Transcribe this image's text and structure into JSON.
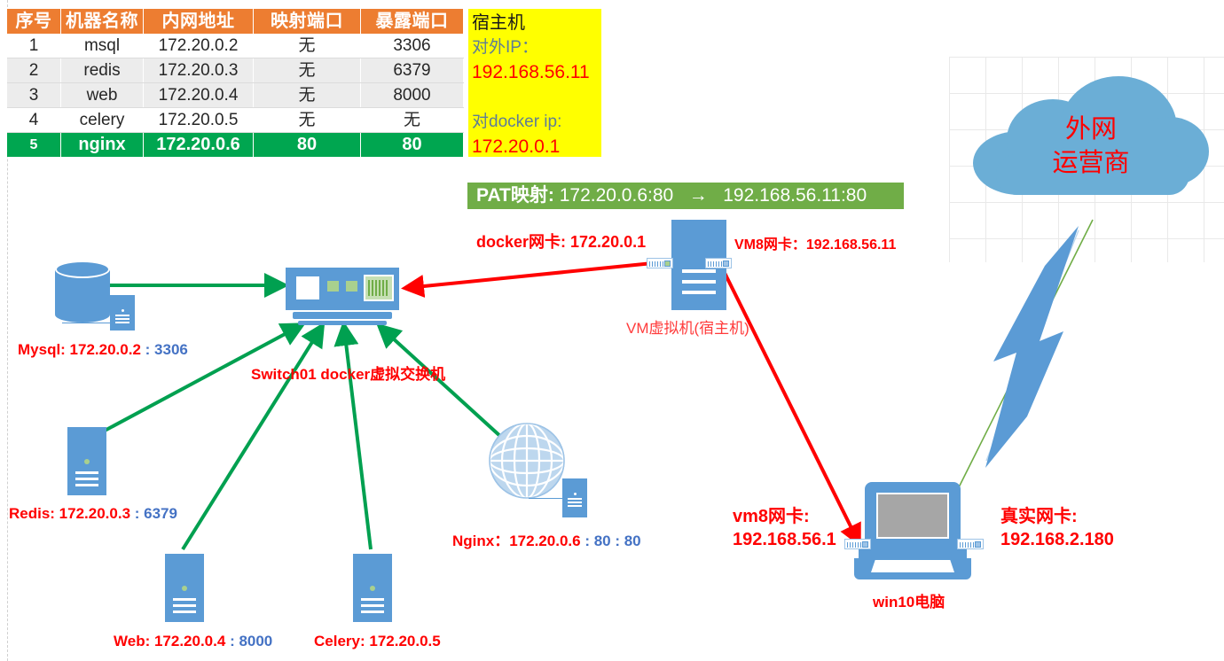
{
  "table": {
    "headers": [
      "序号",
      "机器名称",
      "内网地址",
      "映射端口",
      "暴露端口"
    ],
    "rows": [
      {
        "idx": "1",
        "name": "msql",
        "ip": "172.20.0.2",
        "map": "无",
        "expose": "3306"
      },
      {
        "idx": "2",
        "name": "redis",
        "ip": "172.20.0.3",
        "map": "无",
        "expose": "6379"
      },
      {
        "idx": "3",
        "name": "web",
        "ip": "172.20.0.4",
        "map": "无",
        "expose": "8000"
      },
      {
        "idx": "4",
        "name": "celery",
        "ip": "172.20.0.5",
        "map": "无",
        "expose": "无"
      },
      {
        "idx": "5",
        "name": "nginx",
        "ip": "172.20.0.6",
        "map": "80",
        "expose": "80"
      }
    ]
  },
  "host_box": {
    "title": "宿主机",
    "external_ip_label": "对外IP：",
    "external_ip": "192.168.56.11",
    "docker_ip_label": "对docker ip:",
    "docker_ip": "172.20.0.1"
  },
  "pat_banner": {
    "prefix": "PAT映射:",
    "source": "172.20.0.6:80",
    "arrow": "→",
    "target": "192.168.56.11:80"
  },
  "labels": {
    "docker_nic": "docker网卡: 172.20.0.1",
    "vm8_nic": "VM8网卡：192.168.56.11",
    "vm_machine": "VM虚拟机(宿主机)",
    "switch": "Switch01 docker虚拟交换机",
    "mysql_name": "Mysql: 172.20.0.2",
    "mysql_port": ": 3306",
    "redis_name": "Redis: 172.20.0.3",
    "redis_port": ": 6379",
    "web_name": "Web: 172.20.0.4",
    "web_port": ": 8000",
    "celery_name": "Celery: 172.20.0.5",
    "nginx_name": "Nginx：172.20.0.6",
    "nginx_port": ": 80 : 80",
    "vm8_card_line1": "vm8网卡:",
    "vm8_card_line2": "192.168.56.1",
    "real_card_line1": "真实网卡:",
    "real_card_line2": "192.168.2.180",
    "win10": "win10电脑",
    "cloud_line1": "外网",
    "cloud_line2": "运营商"
  },
  "colors": {
    "header_orange": "#ED7D31",
    "row_green": "#00A650",
    "banner_green": "#70AD47",
    "yellow": "#FFFF00",
    "red": "#FF0000",
    "blue": "#4472C4",
    "device_blue": "#5B9BD5",
    "cloud_blue": "#6BAED6",
    "arrow_green": "#00A050"
  }
}
